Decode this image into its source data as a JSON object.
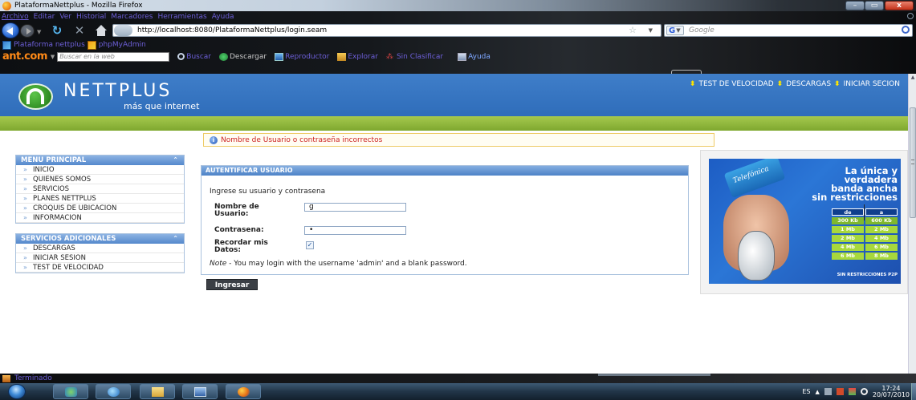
{
  "window": {
    "title": "PlataformaNettplus - Mozilla Firefox",
    "controls": {
      "minimize": "–",
      "maximize": "▭",
      "close": "x"
    }
  },
  "menubar": [
    "Archivo",
    "Editar",
    "Ver",
    "Historial",
    "Marcadores",
    "Herramientas",
    "Ayuda"
  ],
  "navbar": {
    "url": "http://localhost:8080/PlataformaNettplus/login.seam",
    "search_placeholder": "Google",
    "search_engine_letter": "G"
  },
  "bookmarks": [
    "Plataforma nettplus",
    "phpMyAdmin"
  ],
  "ant_toolbar": {
    "logo": "ant.com",
    "search_placeholder": "Buscar en la web",
    "items": [
      "Buscar",
      "Descargar",
      "Reproductor",
      "Explorar",
      "Sin Clasificar",
      "Ayuda"
    ]
  },
  "site": {
    "brand": "NETTPLUS",
    "tagline": "más que internet",
    "topnav": [
      "TEST DE VELOCIDAD",
      "DESCARGAS",
      "INICIAR SECION"
    ],
    "error_message": "Nombre de Usuario o contraseña incorrectos"
  },
  "menu_principal": {
    "title": "MENU PRINCIPAL",
    "items": [
      "INICIO",
      "QUIENES SOMOS",
      "SERVICIOS",
      "PLANES NETTPLUS",
      "CROQUIS DE UBICACION",
      "INFORMACION"
    ]
  },
  "servicios_adicionales": {
    "title": "SERVICIOS ADICIONALES",
    "items": [
      "DESCARGAS",
      "INICIAR SESION",
      "TEST DE VELOCIDAD"
    ]
  },
  "login": {
    "panel_title": "AUTENTIFICAR USUARIO",
    "intro": "Ingrese su usuario y contrasena",
    "username_label": "Nombre de Usuario:",
    "username_value": "g",
    "password_label": "Contrasena:",
    "password_value": "•",
    "remember_label": "Recordar mis Datos:",
    "remember_checked": true,
    "note_prefix": "Note",
    "note_text": " - You may login with the username 'admin' and a blank password.",
    "submit_label": "Ingresar"
  },
  "ad": {
    "brand": "Telefónica",
    "headline": [
      "La única y",
      "verdadera",
      "banda ancha",
      "sin restricciones"
    ],
    "table_header": [
      "de",
      "a"
    ],
    "table_rows": [
      [
        "300 Kb",
        "600 Kb"
      ],
      [
        "1 Mb",
        "2 Mb"
      ],
      [
        "2 Mb",
        "4 Mb"
      ],
      [
        "4 Mb",
        "6 Mb"
      ],
      [
        "6 Mb",
        "8 Mb"
      ]
    ],
    "footer": "SIN RESTRICCIONES P2P"
  },
  "status": {
    "text": "Terminado"
  },
  "taskbar": {
    "language": "ES",
    "time": "17:24",
    "date": "20/07/2010"
  }
}
